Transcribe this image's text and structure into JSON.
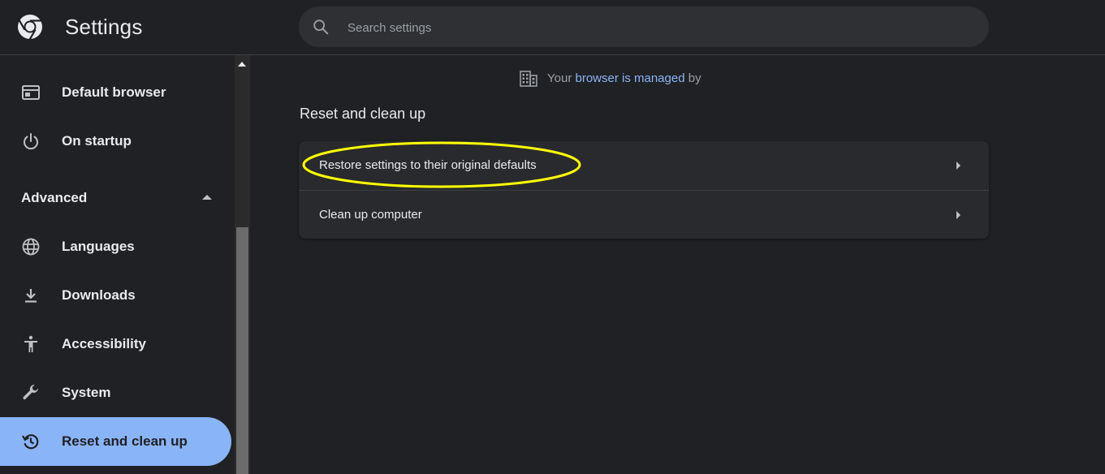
{
  "app": {
    "title": "Settings",
    "logo_icon": "chrome-logo-icon"
  },
  "search": {
    "placeholder": "Search settings",
    "icon": "search-icon"
  },
  "sidebar": {
    "items": [
      {
        "label": "Default browser",
        "icon": "browser-window-icon"
      },
      {
        "label": "On startup",
        "icon": "power-icon"
      },
      {
        "label": "Languages",
        "icon": "globe-icon"
      },
      {
        "label": "Downloads",
        "icon": "download-icon"
      },
      {
        "label": "Accessibility",
        "icon": "accessibility-icon"
      },
      {
        "label": "System",
        "icon": "wrench-icon"
      },
      {
        "label": "Reset and clean up",
        "icon": "history-icon",
        "active": true
      }
    ],
    "advanced_label": "Advanced",
    "advanced_expanded": true
  },
  "managed_notice": {
    "prefix": "Your",
    "link": "browser is managed",
    "suffix": "by",
    "icon": "building-icon"
  },
  "main": {
    "section_title": "Reset and clean up",
    "rows": [
      {
        "label": "Restore settings to their original defaults",
        "highlighted": true
      },
      {
        "label": "Clean up computer",
        "highlighted": false
      }
    ]
  },
  "colors": {
    "background": "#202124",
    "accent": "#8ab4f8",
    "highlight_ellipse": "#ffff00"
  }
}
